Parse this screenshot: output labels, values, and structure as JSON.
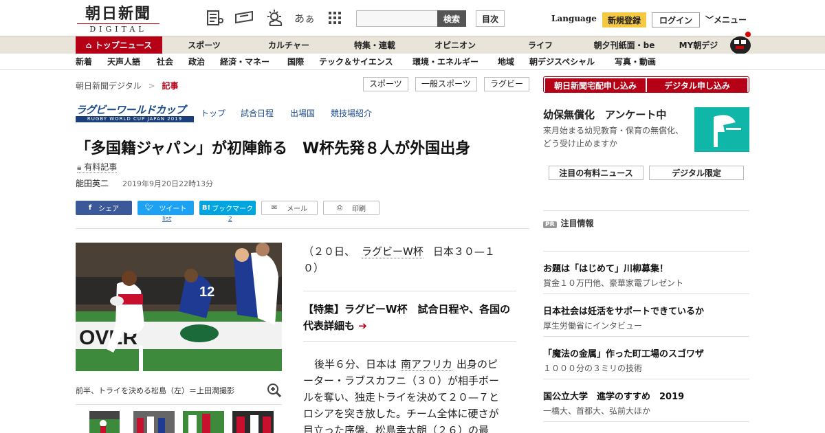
{
  "header": {
    "logo_main": "朝日新聞",
    "logo_sub": "DIGITAL",
    "search_button": "検索",
    "toc_button": "目次",
    "language": "Language",
    "register": "新規登録",
    "login": "ログイン",
    "menu": "メニュー",
    "font_size_label": "あぁ"
  },
  "nav_main": [
    "トップニュース",
    "スポーツ",
    "カルチャー",
    "特集・連載",
    "オピニオン",
    "ライフ",
    "朝夕刊紙面・be",
    "MY朝デジ"
  ],
  "nav_sub": [
    "新着",
    "天声人語",
    "社会",
    "政治",
    "経済・マネー",
    "国際",
    "テック＆サイエンス",
    "環境・エネルギー",
    "地域",
    "朝デジスペシャル",
    "写真・動画"
  ],
  "breadcrumb": {
    "home": "朝日新聞デジタル",
    "separator": ">",
    "current": "記事"
  },
  "tags": [
    "スポーツ",
    "一般スポーツ",
    "ラグビー"
  ],
  "rugby": {
    "logo_main": "ラグビーワールドカップ",
    "logo_sub": "RUGBY WORLD CUP JAPAN 2019",
    "links": [
      "トップ",
      "試合日程",
      "出場国",
      "競技場紹介"
    ]
  },
  "article": {
    "headline": "「多国籍ジャパン」が初陣飾る　W杯先発８人が外国出身",
    "paid_label": "有料記事",
    "author": "能田英二",
    "date": "2019年9月20日22時13分",
    "share": {
      "facebook": "シェア",
      "twitter": "ツイート",
      "hatena": "ブックマーク",
      "mail": "メール",
      "print": "印刷",
      "twitter_count": "list",
      "hatena_count": "2"
    },
    "caption": "前半、トライを決める松島（左）＝上田潤撮影",
    "lead_prefix": "（２０日、",
    "lead_link": "ラグビーW杯",
    "lead_suffix": "日本３０—１",
    "lead_line2": "０）",
    "feature": "【特集】ラグビーW杯　試合日程や、各国の代表詳細も",
    "body_line1_a": "後半６分、日本は",
    "body_line1_link": "南アフリカ",
    "body_line1_b": "出身のピ",
    "body_line2": "ーター・ラブスカフニ（３０）が相手ボー",
    "body_line3": "ルを奪い、独走トライを決めて２０—７と",
    "body_line4": "ロシアを突き放した。チーム全体に硬さが",
    "body_line5": "目立った序盤、松島幸太朗（２６）の最"
  },
  "sidebar": {
    "subscribe_paper": "朝日新聞宅配申し込み",
    "subscribe_digital": "デジタル申し込み",
    "ad_title": "幼保無償化　アンケート中",
    "ad_text": "来月始まる幼児教育・保育の無償化、どう受け止めますか",
    "btn_paid_news": "注目の有料ニュース",
    "btn_digital_only": "デジタル限定",
    "attention_badge": "PR",
    "attention_label": "注目情報",
    "items": [
      {
        "title": "お題は「はじめて」川柳募集！",
        "sub": "賞金１０万円他、豪華家電プレゼント"
      },
      {
        "title": "日本社会は妊活をサポートできているか",
        "sub": "厚生労働省にインタビュー"
      },
      {
        "title": "「魔法の金属」作った町工場のスゴワザ",
        "sub": "１０００分の３ミリの技術"
      },
      {
        "title": "国公立大学　進学のすすめ　2019",
        "sub": "一橋大、首都大、弘前大ほか"
      }
    ]
  },
  "colors": {
    "brand_red": "#b50015",
    "teal": "#10b7a8",
    "facebook": "#3b5998",
    "twitter": "#1da1f2",
    "hatena": "#00a4de",
    "register_yellow": "#f4c842"
  }
}
